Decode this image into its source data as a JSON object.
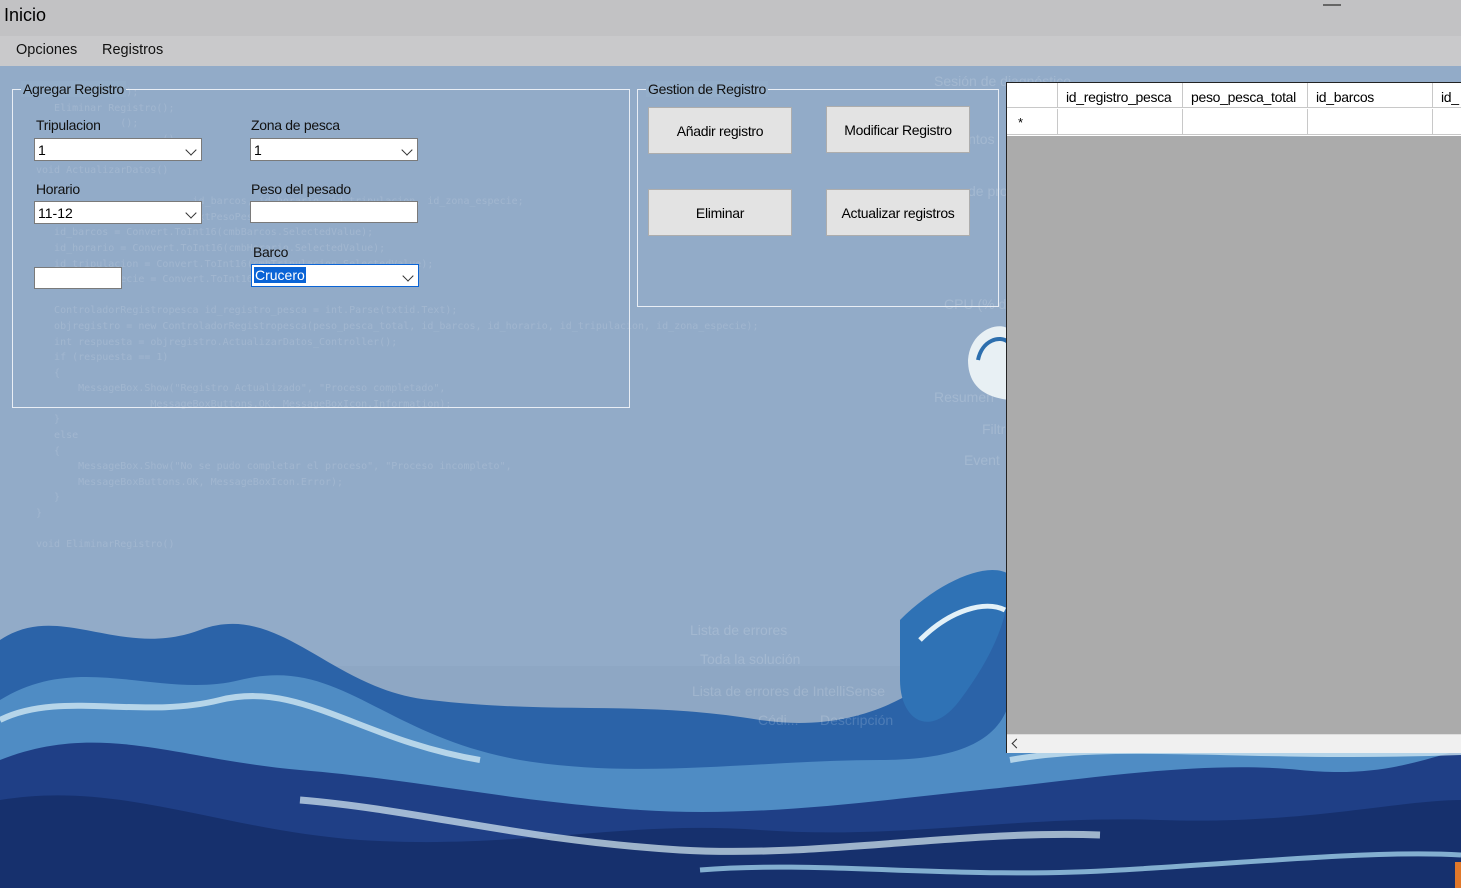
{
  "app": {
    "title": "Inicio"
  },
  "menu": {
    "items": [
      {
        "label": "Opciones"
      },
      {
        "label": "Registros"
      }
    ]
  },
  "agregar": {
    "title": "Agregar Registro",
    "tripulacion": {
      "label": "Tripulacion",
      "value": "1"
    },
    "zona": {
      "label": "Zona de pesca",
      "value": "1"
    },
    "horario": {
      "label": "Horario",
      "value": "11-12"
    },
    "peso": {
      "label": "Peso del pesado",
      "value": ""
    },
    "barco": {
      "label": "Barco",
      "value": "Crucero"
    },
    "id_field": {
      "value": ""
    }
  },
  "gestion": {
    "title": "Gestion de Registro",
    "buttons": {
      "add": "Añadir registro",
      "modify": "Modificar Registro",
      "delete": "Eliminar",
      "update": "Actualizar registros"
    }
  },
  "grid": {
    "columns": [
      "id_registro_pesca",
      "peso_pesca_total",
      "id_barcos",
      "id_"
    ],
    "new_row_marker": "*"
  },
  "colors": {
    "background": "#8ea7c4",
    "menubar": "#c9c9cb",
    "selection": "#0a64d6",
    "wave_dark": "#1f3f86",
    "wave_mid": "#2a6fb0",
    "wave_light": "#7ec6e4"
  }
}
